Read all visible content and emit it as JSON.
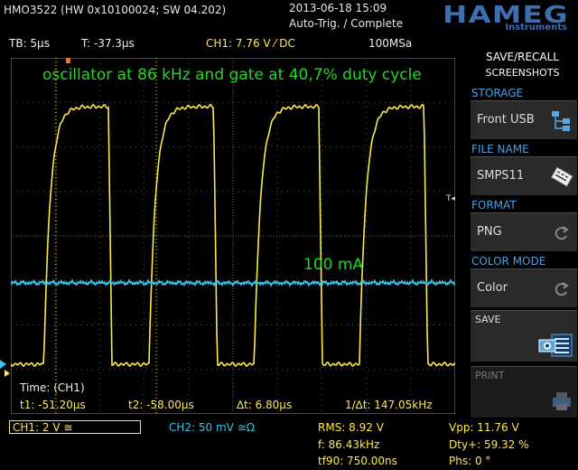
{
  "header": {
    "model": "HMO3522 (HW 0x10100024; SW 04.202)",
    "datetime": "2013-06-18 15:09",
    "trigger_status": "Auto-Trig. / Complete",
    "logo": "HAMEG",
    "logo_sub": "Instruments"
  },
  "settings": {
    "timebase": "TB: 5µs",
    "trigger_time": "T: -37.3µs",
    "ch1_trigger": "CH1: 7.76 V ⁄ DC",
    "sample_rate": "100MSa"
  },
  "annotations": {
    "title": "oscillator at 86 kHz and gate at 40,7% duty cycle",
    "current": "100 mA"
  },
  "cursors": {
    "time_label": "Time: (CH1)",
    "t1": "t1: -51.20µs",
    "t2": "t2: -58.00µs",
    "delta": "∆t: 6.80µs",
    "freq": "1/∆t: 147.05kHz"
  },
  "menu": {
    "title_line1": "SAVE/RECALL",
    "title_line2": "SCREENSHOTS",
    "storage_label": "STORAGE",
    "storage_value": "Front USB",
    "file_name_label": "FILE NAME",
    "file_name_value": "SMPS11",
    "format_label": "FORMAT",
    "format_value": "PNG",
    "color_mode_label": "COLOR MODE",
    "color_mode_value": "Color",
    "save_label": "SAVE",
    "print_label": "PRINT"
  },
  "bottom": {
    "ch1": "CH1: 2 V ≅",
    "ch2": "CH2: 50 mV ≅Ω",
    "rms": "RMS: 8.92 V",
    "freq": "f: 86.43kHz",
    "tf90": "tf90: 750.00ns",
    "vpp": "Vpp: 11.76 V",
    "duty": "Dty+: 59.32 %",
    "phase": "Phs: 0 °"
  },
  "colors": {
    "ch1": "#ffe84a",
    "ch2": "#39c3e6",
    "annotation": "#22d822",
    "menu_category": "#4ea0e0",
    "logo": "#3d6fb0"
  },
  "icons": {
    "storage": "usb-tree-icon",
    "file_name": "keyboard-icon",
    "format": "cycle-arrow-icon",
    "color_mode": "cycle-arrow-icon",
    "save": "camera-screen-icon",
    "print": "printer-icon"
  }
}
